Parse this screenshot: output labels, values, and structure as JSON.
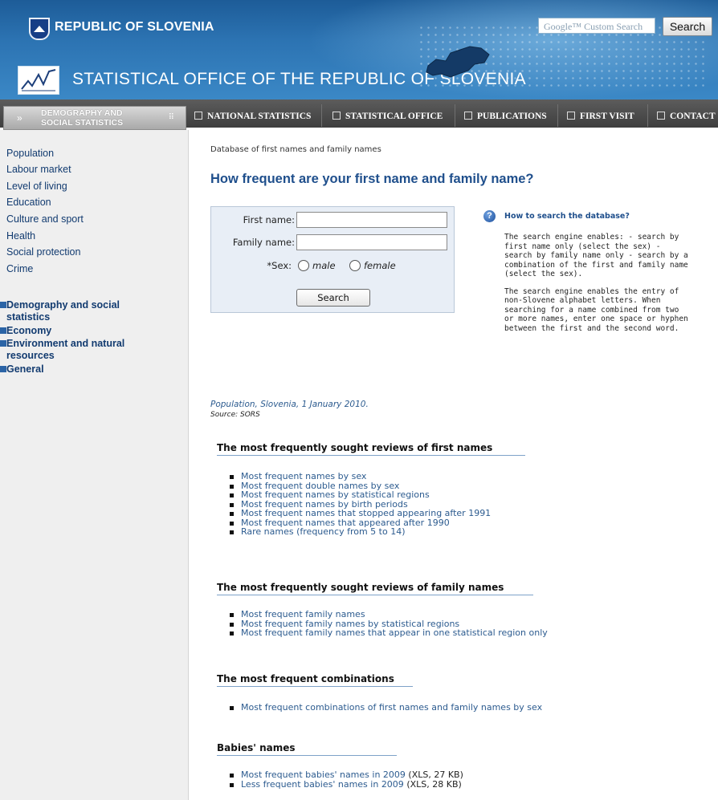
{
  "header": {
    "republic": "REPUBLIC OF SLOVENIA",
    "office": "STATISTICAL OFFICE OF THE REPUBLIC OF SLOVENIA",
    "search_placeholder": "Google™ Custom Search",
    "search_button": "Search",
    "icons": [
      "arrow-right-icon",
      "home-icon",
      "mail-icon",
      "slovenia-flag-icon"
    ]
  },
  "nav": {
    "first": "DEMOGRAPHY AND SOCIAL STATISTICS",
    "items": [
      "NATIONAL STATISTICS",
      "STATISTICAL OFFICE",
      "PUBLICATIONS",
      "FIRST VISIT",
      "CONTACT"
    ]
  },
  "sidebar": {
    "links": [
      "Population",
      "Labour market",
      "Level of living",
      "Education",
      "Culture and sport",
      "Health",
      "Social protection",
      "Crime"
    ],
    "categories": [
      "Demography and social statistics",
      "Economy",
      "Environment and natural resources",
      "General"
    ]
  },
  "main": {
    "breadcrumb": "Database of first names and family names",
    "title": "How frequent are your first name and family name?",
    "form": {
      "first_name_label": "First name:",
      "first_name_value": "",
      "family_name_label": "Family name:",
      "family_name_value": "",
      "sex_label": "*Sex:",
      "male": "male",
      "female": "female",
      "search_button": "Search"
    },
    "help": {
      "title": "How to search the database?",
      "p1": "The search engine enables: - search by first name only (select the sex) - search by family name only - search by a combination of the first and family name (select the sex).",
      "p2": "The search engine enables the entry of non-Slovene alphabet letters. When searching for a name combined from two or more names, enter one space or hyphen between the first and the second word."
    },
    "note": "Population, Slovenia, 1 January 2010.",
    "source": "Source: SORS",
    "sections": [
      {
        "heading": "The most frequently sought reviews of first names",
        "items": [
          "Most frequent names by sex",
          "Most frequent double names by sex",
          "Most frequent names by statistical regions",
          "Most frequent names by birth periods",
          "Most frequent names that stopped appearing after 1991",
          "Most frequent names that appeared after 1990",
          "Rare names (frequency from 5 to 14)"
        ]
      },
      {
        "heading": "The most frequently sought reviews of family names",
        "items": [
          "Most frequent family names",
          "Most frequent family names by statistical regions",
          "Most frequent family names that appear in one statistical region only"
        ]
      },
      {
        "heading": "The most frequent combinations",
        "items": [
          "Most frequent combinations of first names and family names by sex"
        ]
      },
      {
        "heading": "Babies' names",
        "items": [
          "Most frequent babies' names in 2009",
          "Less frequent babies' names in 2009"
        ],
        "extras": [
          "(XLS, 27 KB)",
          "(XLS, 28 KB)"
        ]
      }
    ]
  },
  "colors": {
    "header_blue": "#2c73b2",
    "nav_dark": "#4a4a4a",
    "link_blue": "#2c5b8f",
    "title_blue": "#1f4f8c",
    "sidebar_bg": "#efefef",
    "form_bg": "#e8eef6"
  }
}
